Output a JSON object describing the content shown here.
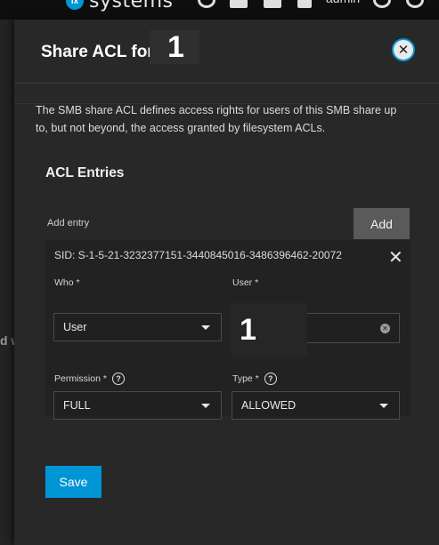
{
  "topbar": {
    "brand_text": "systems",
    "user_label": "admin",
    "icons": [
      "truecommand-icon",
      "apps-icon",
      "directory-services-icon",
      "bell-icon",
      "settings-icon",
      "power-icon"
    ]
  },
  "background": {
    "partial_text": "d w"
  },
  "panel": {
    "title": "Share ACL for",
    "share_name": "1",
    "close_icon": "close-circle-icon",
    "description": "The SMB share ACL defines access rights for users of this SMB share up to, but not beyond, the access granted by filesystem ACLs.",
    "section_title": "ACL Entries",
    "add_label": "Add entry",
    "add_button": "Add",
    "save_button": "Save"
  },
  "entry": {
    "sid": "SID: S-1-5-21-3232377151-3440845016-3486396462-20072",
    "who": {
      "label": "Who *",
      "value": "User"
    },
    "user": {
      "label": "User *",
      "value": "1"
    },
    "permission": {
      "label": "Permission *",
      "value": "FULL"
    },
    "type": {
      "label": "Type *",
      "value": "ALLOWED"
    }
  },
  "colors": {
    "accent": "#0095d5",
    "panel_bg": "#282828",
    "entry_bg": "#222222"
  }
}
